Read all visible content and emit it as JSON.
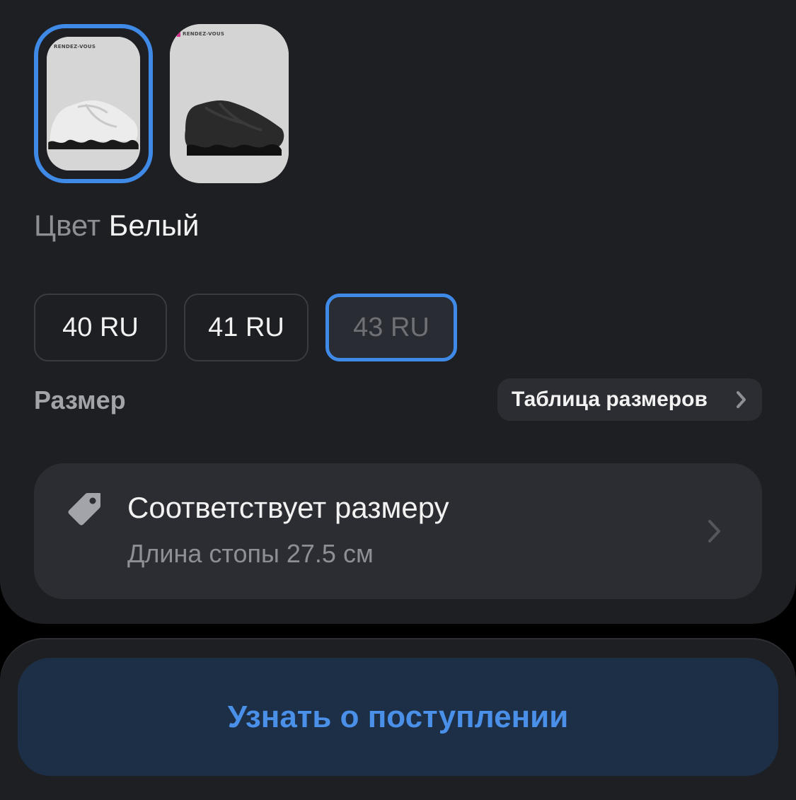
{
  "colors": {
    "accent": "#3f8ae6",
    "background": "#1e1f23",
    "surface": "#2c2d32",
    "button_bg": "#1c2f47",
    "button_text": "#4a90e8"
  },
  "swatches": [
    {
      "brand": "RENDEZ-VOUS",
      "product_color": "white",
      "selected": true
    },
    {
      "brand": "RENDEZ-VOUS",
      "product_color": "black",
      "selected": false
    }
  ],
  "color_selector": {
    "label": "Цвет",
    "value": "Белый"
  },
  "sizes": {
    "options": [
      "40 RU",
      "41 RU",
      "43 RU"
    ],
    "selected": "43 RU",
    "title": "Размер",
    "table_link": "Таблица размеров"
  },
  "fit": {
    "icon": "tag-icon",
    "title": "Соответствует размеру",
    "subtitle": "Длина стопы 27.5 см"
  },
  "notify_button": {
    "label": "Узнать о поступлении"
  }
}
